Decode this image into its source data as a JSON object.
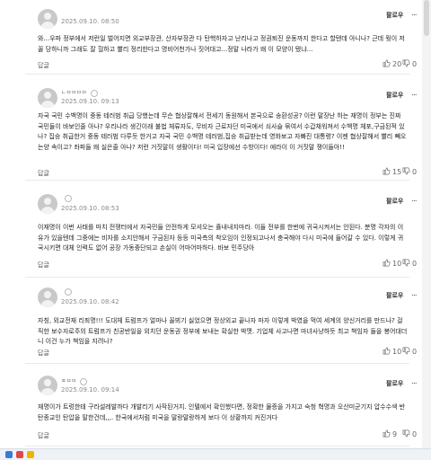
{
  "labels": {
    "follow": "팔로우",
    "reply": "답글",
    "more": "..."
  },
  "comments": [
    {
      "nick": "",
      "date": "2025.09.10. 08:50",
      "text": "와...우파 정부에서 저런일 벌어지면 외교부장관, 산자부장관 다 탄핵하자고 난리나고 정권퇴진 운동까지 한다고 할텐데 아니나? 근데 뭣이 저꼴 당하니까 그래도 잘 헐하고 빨리 정리한다고 명비어천가나 짓어대고...정말 나라가 왜 이 모양이 됐냐...",
      "likes": "20",
      "dislikes": "0"
    },
    {
      "nick": "ㄴㅁㅁㅁㅁ",
      "date": "2025.09.10. 09:13",
      "text": "자국 국민 수백명이 중동 테러범 취급 당했는데 무슨 협상잘해서 전세기 동원해서 본국으로 송환성공? 이런 말장난 하는 재명이 정부는 진짜 국민들이 바보인줄 아나? 우리나라 생긴이래 불법 체류자도, 무비자 근로자던 미국에서 쇠사슬 묶여서 수갑채워져서 수백명 체포,구금된적 있나? 집승 취급한거 중동 테러범 다루듯 한거고 자국 국민 수백명 테러범,집승 취급받는데 영화보고 자빠진 대통령? 이젠 협상잘해서 빨리 빼오는양 속이고? 좌파들 왜 실은줄 아나? 저런 거짓말이 생활이다! 미국 입장에선 수방이다! 에라이 이 거짓말 쟁이들아!!",
      "likes": "15",
      "dislikes": "0"
    },
    {
      "nick": "",
      "date": "2025.09.10. 08:53",
      "text": "이재명이 이번 사태를 마치 전쟁터에서 자국민들 안전하게 모셔오는 휼내내지마라. 이들 전부를 한번에 귀국시켜서는 안된다. 분명 각자의 이유가 있을텐데 그중에는 비자를 소지안해서 구금된자 등등 미국측의 착오임이 인정되고나서 충국해야 다시 미국에 들어갈 수 있다. 이렇게 귀국시키면 대체 인력도 없어 공장 가동중단되고 손실이 어마어마하다. 바보 민주당아",
      "likes": "10",
      "dislikes": "0"
    },
    {
      "nick": "",
      "date": "2025.09.10. 08:42",
      "text": "자칭, 외교전재 리죄명!!! 도대체 트럼프가 얼마나 꼴뵈기 싫었으면 정상외교 끝나자 마자 이렇게 박였을 먹여 세계의 양신거리를 만드나? 걸직한 보수자로주의 트럼프가 친공반일을 외치던 운동권 정부에 보내는 확실한 박맷. 기업체 사고나면 마녀사냥하듯 최고 책임자 들을 봉어대더니 이건 누가 책임을 지려나?",
      "likes": "10",
      "dislikes": "0"
    },
    {
      "nick": "ㅍㅁㅁ",
      "date": "2025.09.10. 09:14",
      "text": "재명이가 트렁한테 구라설레발까다 개발리기 사작된거지. 인텔에서 확인했다면, 정확한 물증을 가지고 숙청 혁명과 오산미군기지 압수수색 반탄종교인 탄압을 말한건데,,,. 한국에서처럼 미국을 말랑말랑하게 보다 이 상황까지 커진거다",
      "likes": "9",
      "dislikes": "0"
    }
  ]
}
